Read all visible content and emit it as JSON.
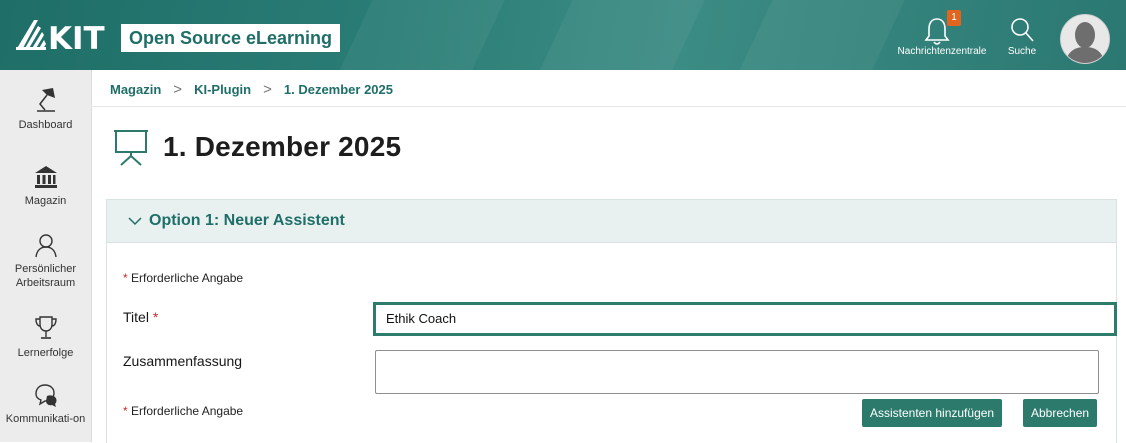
{
  "header": {
    "logo_text": "KIT",
    "brand": "Open Source eLearning",
    "notifications": {
      "label": "Nachrichtenzentrale",
      "count": "1"
    },
    "search_label": "Suche"
  },
  "sidebar": {
    "items": [
      {
        "label": "Dashboard",
        "icon": "lamp-icon"
      },
      {
        "label": "Magazin",
        "icon": "bank-icon"
      },
      {
        "label": "Persönlicher Arbeitsraum",
        "icon": "person-icon"
      },
      {
        "label": "Lernerfolge",
        "icon": "trophy-icon"
      },
      {
        "label": "Kommunikati-on",
        "icon": "chat-icon"
      }
    ]
  },
  "breadcrumb": [
    "Magazin",
    "KI-Plugin",
    "1. Dezember 2025"
  ],
  "page_title": "1. Dezember 2025",
  "form": {
    "section_title": "Option 1: Neuer Assistent",
    "required_note": "Erforderliche Angabe",
    "title_label": "Titel",
    "title_value": "Ethik Coach",
    "summary_label": "Zusammenfassung",
    "summary_value": "",
    "submit_label": "Assistenten hinzufügen",
    "cancel_label": "Abbrechen"
  },
  "colors": {
    "accent": "#1f6e68",
    "button": "#2c7a6c",
    "required": "#c62b2b",
    "badge": "#e0651e"
  }
}
